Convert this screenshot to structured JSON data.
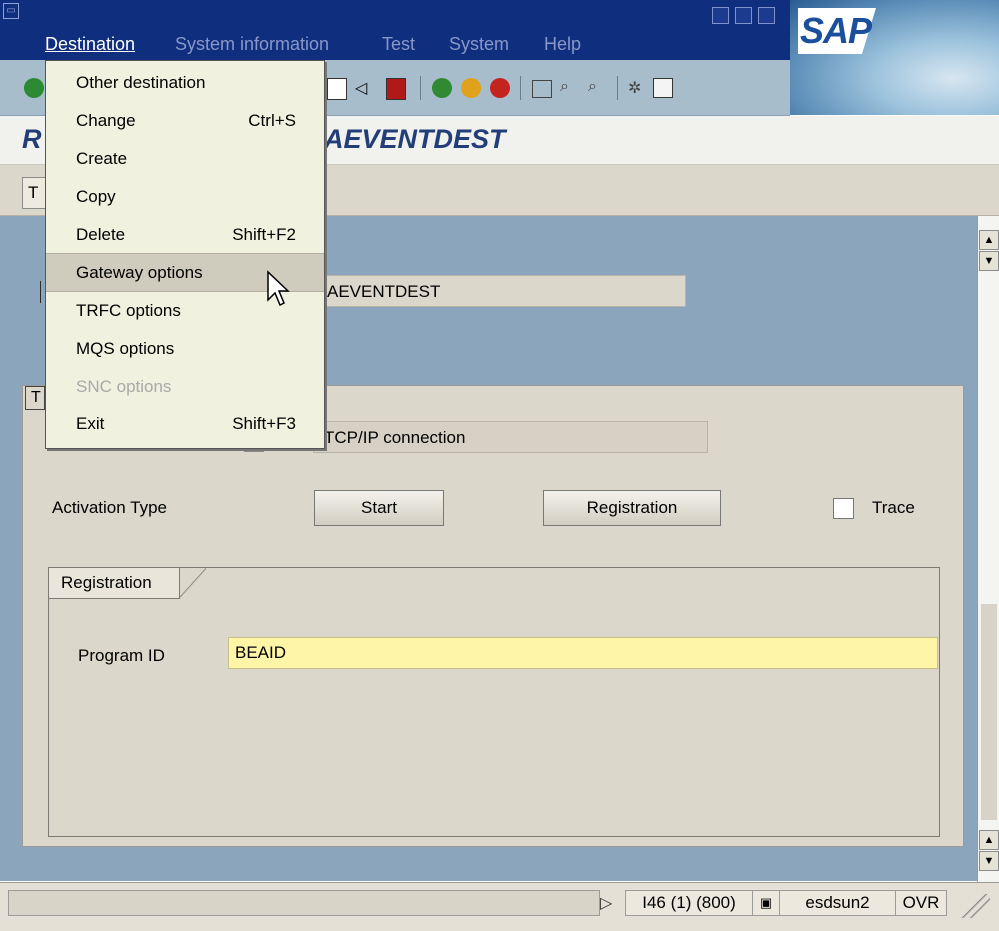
{
  "menubar": {
    "items": [
      "Destination",
      "System information",
      "Test",
      "System",
      "Help"
    ],
    "logo": "SAP"
  },
  "title": "R                         AEVENTDEST",
  "title_left": "R",
  "title_right": "AEVENTDEST",
  "apptoolbar": {
    "tab_label": "T"
  },
  "destination_value": "AEVENTDEST",
  "technical_group_tab": "T",
  "connection_type_value": "TCP/IP connection",
  "activation": {
    "label": "Activation Type",
    "start_label": "Start",
    "registration_label": "Registration",
    "trace_label": "Trace",
    "trace_checked": false
  },
  "registration": {
    "group_title": "Registration",
    "program_id_label": "Program ID",
    "program_id_value": "BEAID"
  },
  "statusbar": {
    "system": "I46 (1) (800)",
    "host": "esdsun2",
    "mode": "OVR"
  },
  "dropdown": {
    "items": [
      {
        "label": "Other destination",
        "shortcut": "",
        "state": "normal"
      },
      {
        "label": "Change",
        "shortcut": "Ctrl+S",
        "state": "normal"
      },
      {
        "label": "Create",
        "shortcut": "",
        "state": "normal"
      },
      {
        "label": "Copy",
        "shortcut": "",
        "state": "normal"
      },
      {
        "label": "Delete",
        "shortcut": "Shift+F2",
        "state": "normal"
      },
      {
        "label": "Gateway options",
        "shortcut": "",
        "state": "highlighted"
      },
      {
        "label": "TRFC options",
        "shortcut": "",
        "state": "normal"
      },
      {
        "label": "MQS options",
        "shortcut": "",
        "state": "normal"
      },
      {
        "label": "SNC options",
        "shortcut": "",
        "state": "disabled"
      },
      {
        "label": "Exit",
        "shortcut": "Shift+F3",
        "state": "normal"
      }
    ]
  },
  "colors": {
    "menubar": "#102e7e",
    "input_highlight": "#fef6a6",
    "background": "#8aa5bc"
  }
}
